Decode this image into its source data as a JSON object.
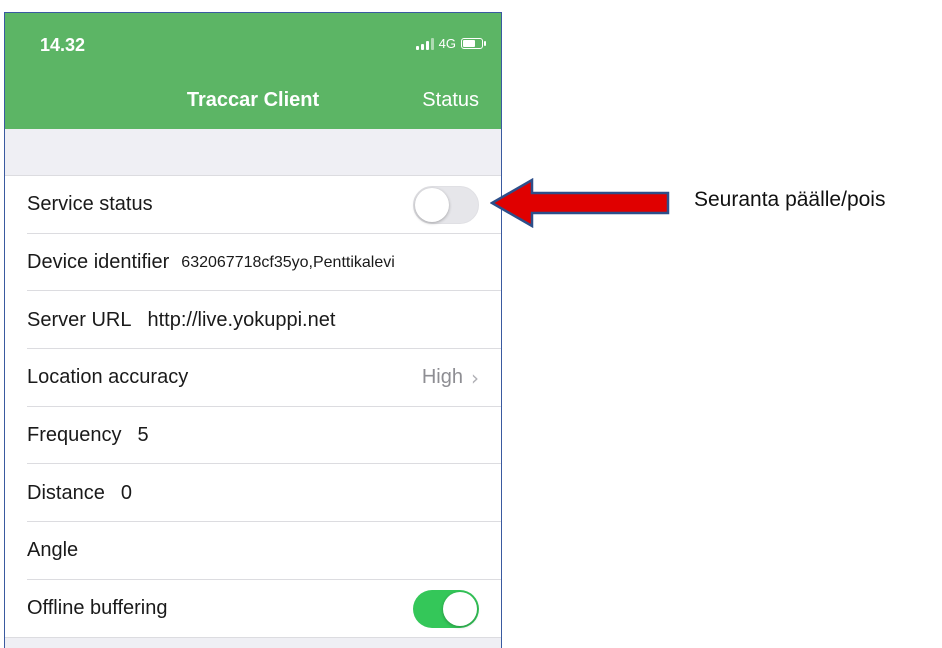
{
  "status_bar": {
    "time": "14.32",
    "network": "4G"
  },
  "nav": {
    "title": "Traccar Client",
    "status_button": "Status"
  },
  "settings": {
    "service_status": {
      "label": "Service status",
      "enabled": false
    },
    "device_identifier": {
      "label": "Device identifier",
      "value": "632067718cf35yo,Penttikalevi"
    },
    "server_url": {
      "label": "Server URL",
      "value": "http://live.yokuppi.net"
    },
    "location_accuracy": {
      "label": "Location accuracy",
      "value": "High"
    },
    "frequency": {
      "label": "Frequency",
      "value": "5"
    },
    "distance": {
      "label": "Distance",
      "value": "0"
    },
    "angle": {
      "label": "Angle",
      "value": ""
    },
    "offline_buffering": {
      "label": "Offline buffering",
      "enabled": true
    }
  },
  "annotation": {
    "text": "Seuranta päälle/pois",
    "arrow_color": "#e00000"
  },
  "colors": {
    "header": "#5cb565",
    "toggle_on": "#34c759",
    "toggle_off": "#e6e6ea",
    "background": "#efeff4"
  },
  "icons": [
    "signal-icon",
    "battery-icon",
    "chevron-right-icon",
    "arrow-left-icon"
  ]
}
